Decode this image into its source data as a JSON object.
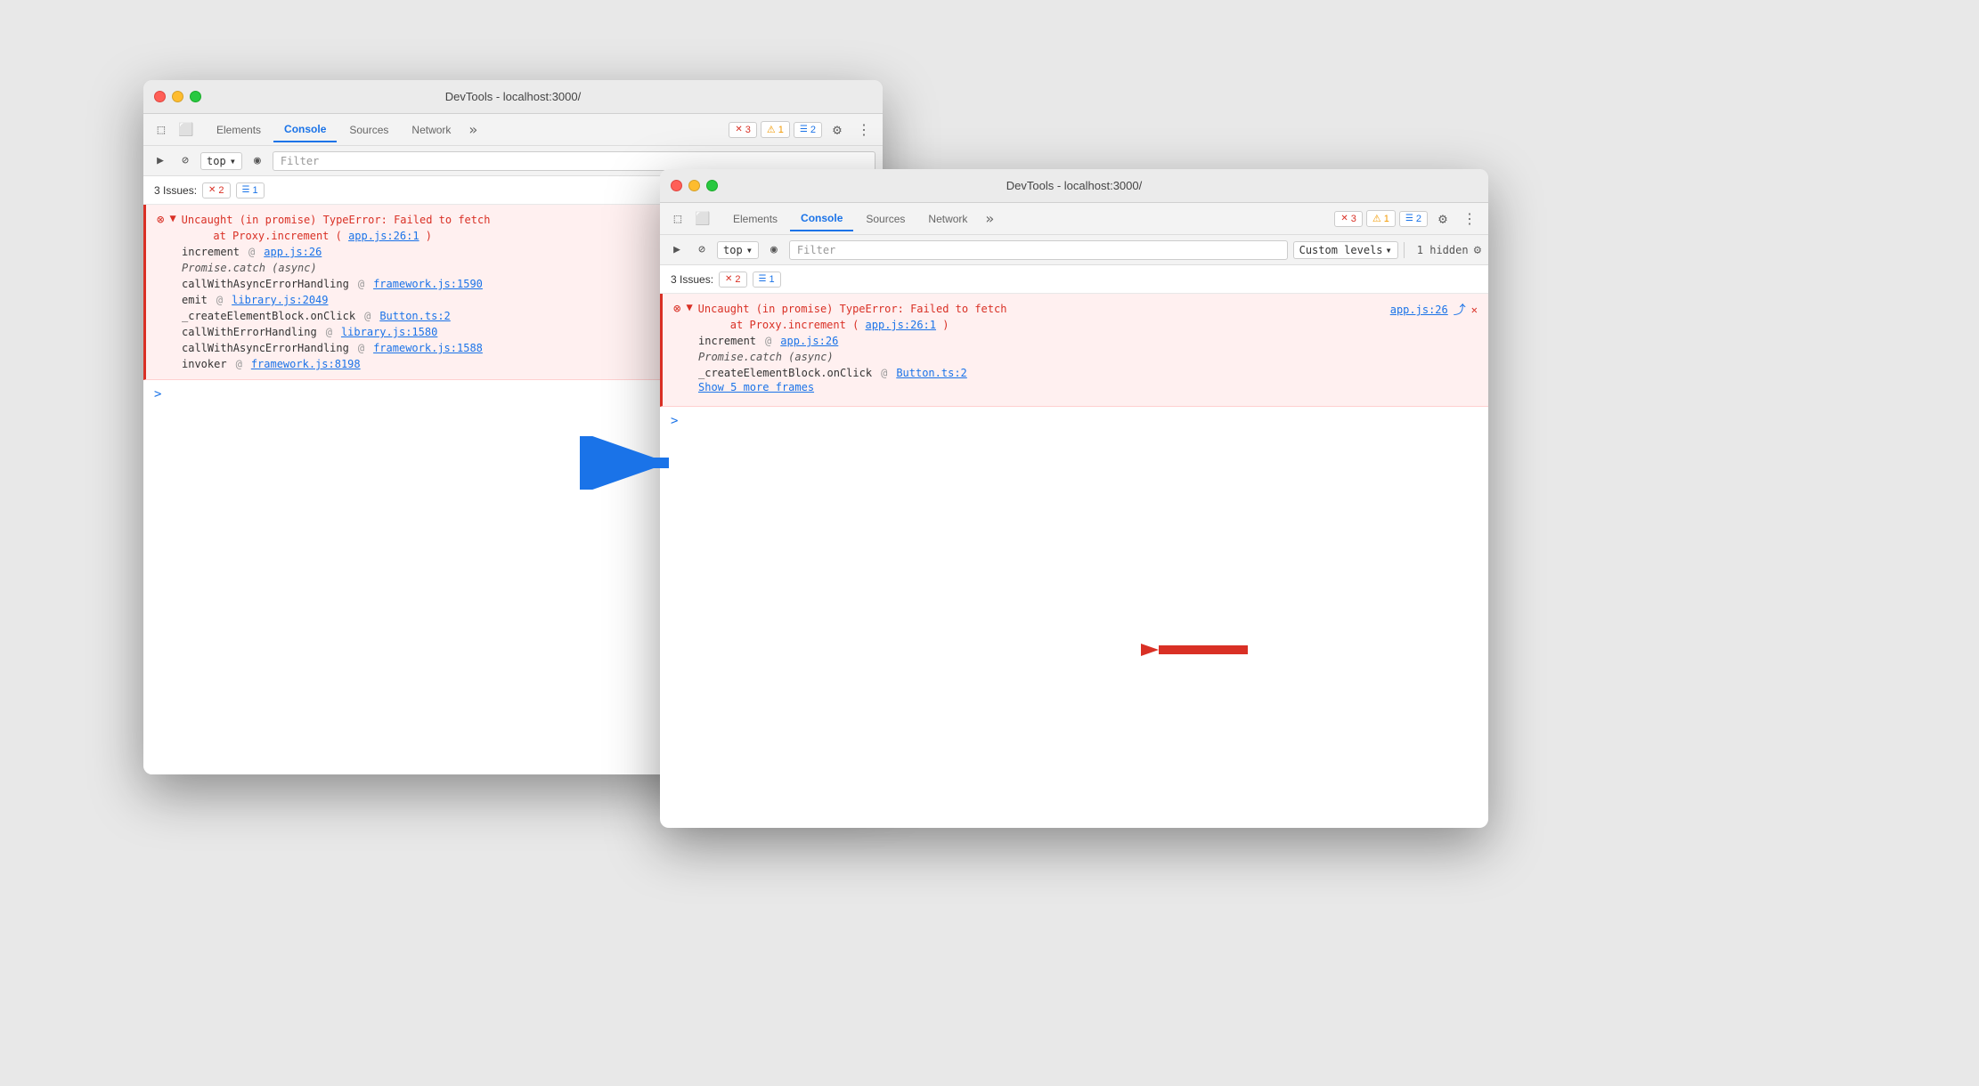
{
  "window1": {
    "title": "DevTools - localhost:3000/",
    "tabs": [
      "Elements",
      "Console",
      "Sources",
      "Network"
    ],
    "active_tab": "Console",
    "more_tabs": "»",
    "badges": {
      "errors": "3",
      "warnings": "1",
      "info": "2"
    },
    "toolbar": {
      "top_label": "top",
      "filter_placeholder": "Filter"
    },
    "issues": {
      "label": "3 Issues:",
      "errors": "2",
      "info": "1"
    },
    "error": {
      "main_text": "Uncaught (in promise) TypeError: Failed to fetch",
      "sub_text": "at Proxy.increment (app.js:26:1)",
      "link_text": "app.js:26",
      "frames": [
        {
          "fn": "increment",
          "at": "@",
          "file": "app.js:26"
        },
        {
          "fn": "Promise.catch (async)",
          "at": "",
          "file": ""
        },
        {
          "fn": "callWithAsyncErrorHandling",
          "at": "@",
          "file": "framework.js:1590"
        },
        {
          "fn": "emit",
          "at": "@",
          "file": "library.js:2049"
        },
        {
          "fn": "_createElementBlock.onClick",
          "at": "@",
          "file": "Button.ts:2"
        },
        {
          "fn": "callWithErrorHandling",
          "at": "@",
          "file": "library.js:1580"
        },
        {
          "fn": "callWithAsyncErrorHandling",
          "at": "@",
          "file": "framework.js:1588"
        },
        {
          "fn": "invoker",
          "at": "@",
          "file": "framework.js:8198"
        }
      ]
    }
  },
  "window2": {
    "title": "DevTools - localhost:3000/",
    "tabs": [
      "Elements",
      "Console",
      "Sources",
      "Network"
    ],
    "active_tab": "Console",
    "more_tabs": "»",
    "badges": {
      "errors": "3",
      "warnings": "1",
      "info": "2"
    },
    "toolbar": {
      "top_label": "top",
      "filter_placeholder": "Filter",
      "custom_levels": "Custom levels",
      "hidden_count": "1 hidden"
    },
    "issues": {
      "label": "3 Issues:",
      "errors": "2",
      "info": "1"
    },
    "error": {
      "main_text": "Uncaught (in promise) TypeError: Failed to fetch",
      "sub_text": "at Proxy.increment (app.js:26:1)",
      "link_text": "app.js:26",
      "frames": [
        {
          "fn": "increment",
          "at": "@",
          "file": "app.js:26"
        },
        {
          "fn": "Promise.catch (async)",
          "at": "",
          "file": ""
        },
        {
          "fn": "_createElementBlock.onClick",
          "at": "@",
          "file": "Button.ts:2"
        }
      ],
      "show_more": "Show 5 more frames"
    }
  },
  "icons": {
    "cursor": "⬚",
    "inspector": "⬜",
    "eye": "◉",
    "prohibit": "⊘",
    "chevron_down": "▾",
    "gear": "⚙",
    "three_dots": "⋮",
    "error_badge": "✕",
    "warn_badge": "⚠",
    "info_badge": "☰",
    "triangle_down": "▼",
    "play": "▶",
    "circle_x": "✕"
  }
}
